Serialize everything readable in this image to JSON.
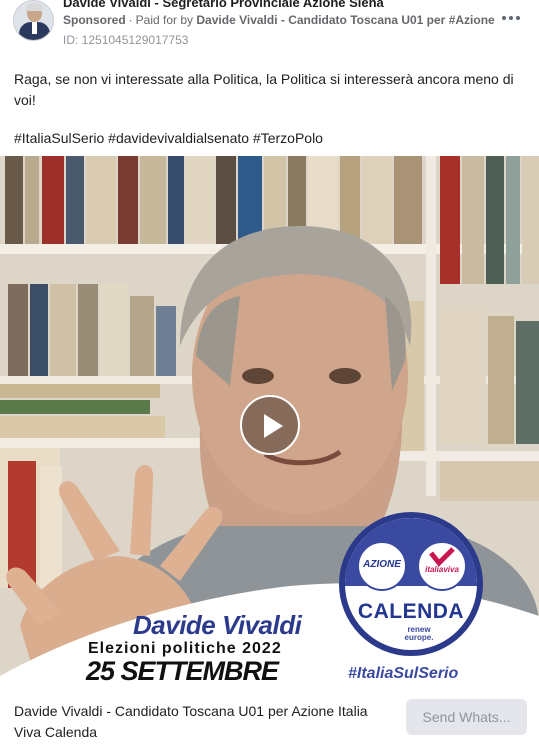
{
  "header": {
    "page_name": "Davide Vivaldi - Segretario Provinciale Azione Siena",
    "sponsored_label": "Sponsored",
    "separator": "·",
    "paid_for_prefix": "Paid for by",
    "funder": "Davide Vivaldi - Candidato Toscana U01 per #Azione",
    "ad_id": "ID: 1251045129017753",
    "more_icon": "more-dots-icon"
  },
  "post": {
    "caption": "Raga, se non vi interessate alla Politica, la Politica si interesserà ancora meno di voi!",
    "hashtags": "#ItaliaSulSerio #davidevivaldialsenato #TerzoPolo"
  },
  "video": {
    "play_icon": "play-icon",
    "overlay": {
      "candidate_name": "Davide Vivaldi",
      "elections": "Elezioni politiche 2022",
      "date": "25 SETTEMBRE",
      "logo_left": "AZIONE",
      "logo_right": "italiaviva",
      "logo_main": "CALENDA",
      "logo_renew": "renew europe.",
      "slogan": "#ItaliaSulSerio"
    }
  },
  "footer": {
    "link_title": "Davide Vivaldi - Candidato Toscana U01 per Azione Italia Viva Calenda",
    "cta_label": "Send Whats..."
  },
  "colors": {
    "brand_blue": "#2c3a8c",
    "accent_pink": "#c8174f",
    "cta_bg": "#e4e6eb"
  }
}
